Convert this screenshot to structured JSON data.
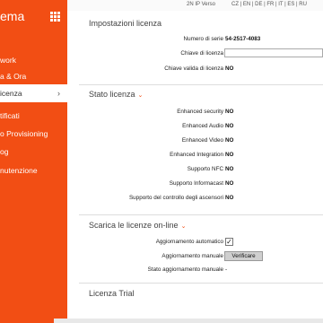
{
  "sidebar": {
    "title": "ema",
    "items": [
      {
        "label": "work"
      },
      {
        "label": "a & Ora"
      },
      {
        "label": "icenza"
      },
      {
        "label": "tificati"
      },
      {
        "label": "o Provisioning"
      },
      {
        "label": "og"
      },
      {
        "label": "nutenzione"
      }
    ],
    "active_chevron": "›"
  },
  "topbar": {
    "version": "2N IP Verso",
    "languages": "CZ | EN | DE | FR | IT | ES | RU"
  },
  "impostazioni": {
    "title": "Impostazioni licenza",
    "serial_label": "Numero di serie",
    "serial_value": "54-2517-4083",
    "key_label": "Chiave di licenza",
    "key_value": "",
    "valid_label": "Chiave valida di licenza",
    "valid_value": "NO"
  },
  "stato": {
    "title": "Stato licenza",
    "rows": [
      {
        "label": "Enhanced security",
        "value": "NO"
      },
      {
        "label": "Enhanced Audio",
        "value": "NO"
      },
      {
        "label": "Enhanced Video",
        "value": "NO"
      },
      {
        "label": "Enhanced Integration",
        "value": "NO"
      },
      {
        "label": "Supporto NFC",
        "value": "NO"
      },
      {
        "label": "Supporto Informacast",
        "value": "NO"
      },
      {
        "label": "Supporto del controllo degli ascensori",
        "value": "NO"
      }
    ]
  },
  "scarica": {
    "title": "Scarica le licenze on-line",
    "auto_label": "Aggiornamento automatico",
    "auto_checked": true,
    "manual_label": "Aggiornamento manuale",
    "verify_button": "Verificare",
    "state_label": "Stato aggiornamento manuale",
    "state_value": "-"
  },
  "next_section": {
    "title": "Licenza Trial"
  },
  "colors": {
    "accent": "#f24e14"
  }
}
